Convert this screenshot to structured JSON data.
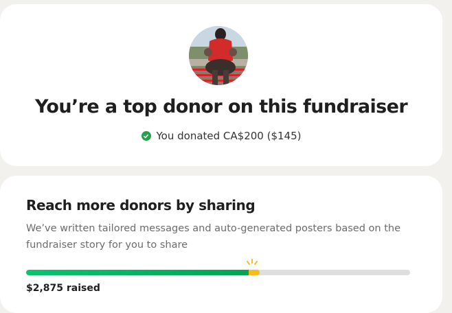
{
  "top_card": {
    "title": "You’re a top donor on this fundraiser",
    "donation_text": "You donated CA$200 ($145)"
  },
  "share_card": {
    "title": "Reach more donors by sharing",
    "description": "We’ve written tailored messages and auto-generated posters based on the fundraiser story for you to share",
    "raised_label": "$2,875 raised",
    "progress_fraction": 0.57
  },
  "icons": {
    "check": "check-circle-icon",
    "sparkle": "sparkle-icon"
  },
  "colors": {
    "progress_green": "#0cc26e",
    "progress_accent": "#f5bb20",
    "check_green": "#27a14f"
  }
}
